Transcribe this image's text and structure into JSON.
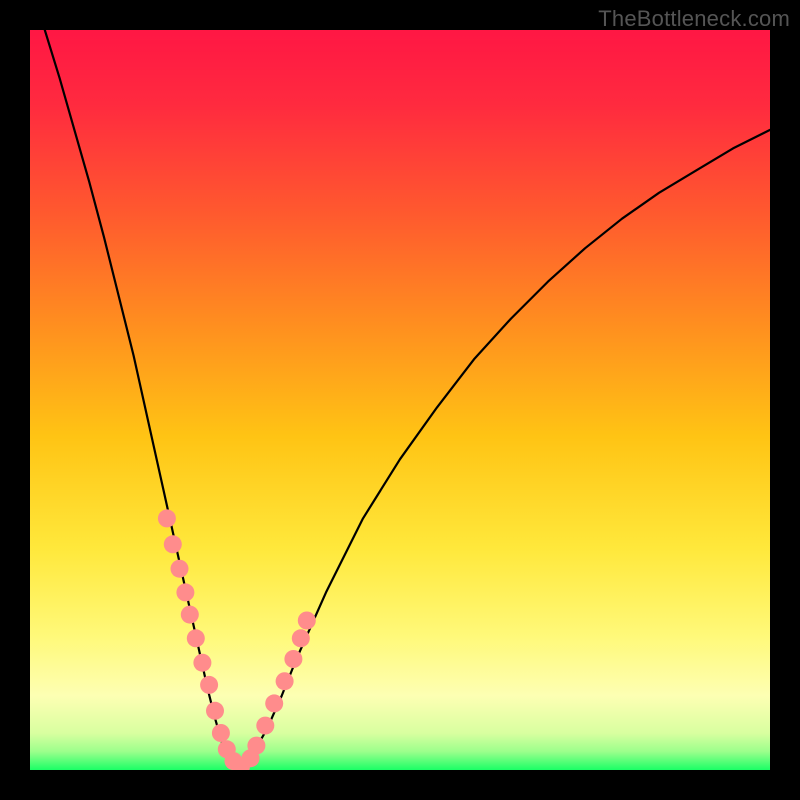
{
  "attribution": "TheBottleneck.com",
  "gradient_stops": [
    {
      "offset": 0.0,
      "color": "#ff1744"
    },
    {
      "offset": 0.1,
      "color": "#ff2a3f"
    },
    {
      "offset": 0.25,
      "color": "#ff5a2e"
    },
    {
      "offset": 0.4,
      "color": "#ff8f1f"
    },
    {
      "offset": 0.55,
      "color": "#ffc414"
    },
    {
      "offset": 0.7,
      "color": "#ffe83b"
    },
    {
      "offset": 0.82,
      "color": "#fff97a"
    },
    {
      "offset": 0.9,
      "color": "#fdffb3"
    },
    {
      "offset": 0.95,
      "color": "#d9ffa0"
    },
    {
      "offset": 0.975,
      "color": "#9cff8c"
    },
    {
      "offset": 1.0,
      "color": "#1aff66"
    }
  ],
  "marker_color": "#ff8c8c",
  "marker_radius": 9,
  "curve_color": "#000000",
  "curve_width": 2.2,
  "chart_data": {
    "type": "line",
    "title": "",
    "xlabel": "",
    "ylabel": "",
    "xlim": [
      0,
      100
    ],
    "ylim": [
      0,
      100
    ],
    "grid": false,
    "series": [
      {
        "name": "curve",
        "x": [
          2,
          4,
          6,
          8,
          10,
          12,
          14,
          16,
          18,
          20,
          21,
          22,
          23,
          24,
          25,
          26,
          27,
          28,
          29,
          30,
          32,
          34,
          36,
          40,
          45,
          50,
          55,
          60,
          65,
          70,
          75,
          80,
          85,
          90,
          95,
          100
        ],
        "y": [
          100,
          93.5,
          86.5,
          79.5,
          72,
          64,
          56,
          47,
          38,
          29,
          24.5,
          20,
          15.5,
          11,
          7,
          3.5,
          1,
          0,
          0.8,
          2,
          5.5,
          10,
          15,
          24,
          34,
          42,
          49,
          55.5,
          61,
          66,
          70.5,
          74.5,
          78,
          81,
          84,
          86.5
        ]
      },
      {
        "name": "markers",
        "style": "scatter",
        "x": [
          18.5,
          19.3,
          20.2,
          21.0,
          21.6,
          22.4,
          23.3,
          24.2,
          25.0,
          25.8,
          26.6,
          27.5,
          28.5,
          29.8,
          30.6,
          31.8,
          33.0,
          34.4,
          35.6,
          36.6,
          37.4
        ],
        "y": [
          34.0,
          30.5,
          27.2,
          24.0,
          21.0,
          17.8,
          14.5,
          11.5,
          8.0,
          5.0,
          2.8,
          1.2,
          0.4,
          1.6,
          3.3,
          6.0,
          9.0,
          12.0,
          15.0,
          17.8,
          20.2
        ]
      }
    ]
  }
}
